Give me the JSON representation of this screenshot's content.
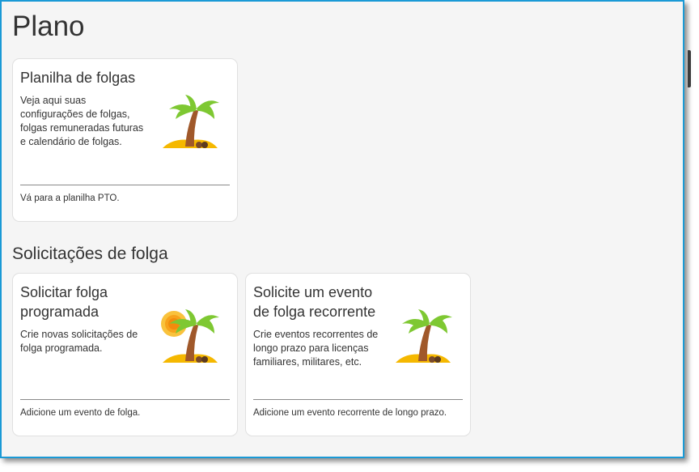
{
  "page": {
    "title": "Plano"
  },
  "plan_card": {
    "title": "Planilha de folgas",
    "description": "Veja aqui suas configurações de folgas, folgas remuneradas futuras e calendário de folgas.",
    "link": "Vá para a planilha PTO.",
    "icon": "palm-island-icon"
  },
  "requests_section": {
    "title": "Solicitações de folga",
    "cards": [
      {
        "title": "Solicitar folga programada",
        "description": "Crie novas solicitações de folga programada.",
        "link": "Adicione um evento de folga.",
        "icon": "palm-island-sun-icon"
      },
      {
        "title": "Solicite um evento de folga recorrente",
        "description": "Crie eventos recorrentes de longo prazo para licenças familiares, militares, etc.",
        "link": "Adicione um evento recorrente de longo prazo.",
        "icon": "palm-island-icon"
      }
    ]
  },
  "colors": {
    "window_border": "#1a9ad6",
    "page_background": "#f5f5f5",
    "card_background": "#ffffff",
    "palm_leaves": "#7ec832",
    "palm_trunk": "#a0582a",
    "sand": "#f5b800",
    "sun": "#f7a21b"
  }
}
